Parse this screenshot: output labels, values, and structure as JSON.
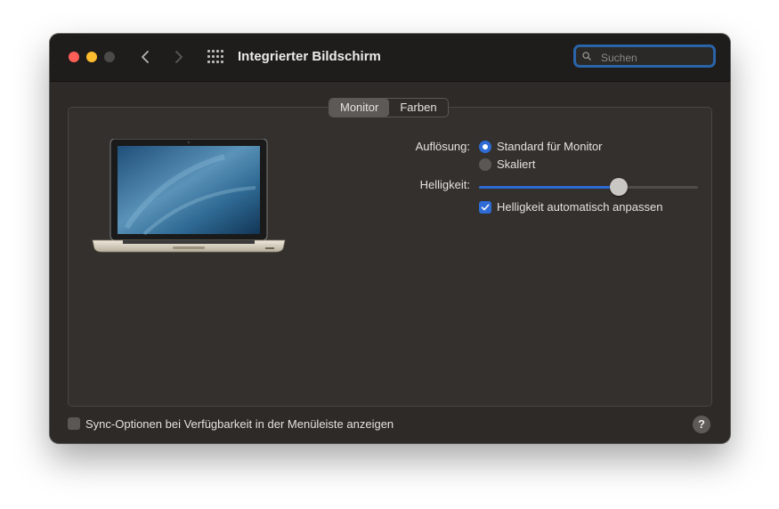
{
  "window": {
    "title": "Integrierter Bildschirm"
  },
  "search": {
    "placeholder": "Suchen",
    "value": ""
  },
  "tabs": [
    {
      "label": "Monitor",
      "selected": true
    },
    {
      "label": "Farben",
      "selected": false
    }
  ],
  "resolution": {
    "label": "Auflösung:",
    "options": [
      {
        "label": "Standard für Monitor",
        "selected": true
      },
      {
        "label": "Skaliert",
        "selected": false
      }
    ]
  },
  "brightness": {
    "label": "Helligkeit:",
    "level": 0.64,
    "auto_label": "Helligkeit automatisch anpassen",
    "auto_checked": true
  },
  "sync": {
    "label": "Sync-Optionen bei Verfügbarkeit in der Menüleiste anzeigen",
    "checked": false
  },
  "help": {
    "label": "?"
  },
  "colors": {
    "accent": "#2f6bd4",
    "close": "#ff5f57",
    "minimize": "#febc2e",
    "search_focus": "#2a64a8"
  },
  "icons": [
    "chevron-left-icon",
    "chevron-right-icon",
    "grid-icon",
    "search-icon",
    "laptop-icon",
    "checkmark-icon",
    "question-icon"
  ]
}
